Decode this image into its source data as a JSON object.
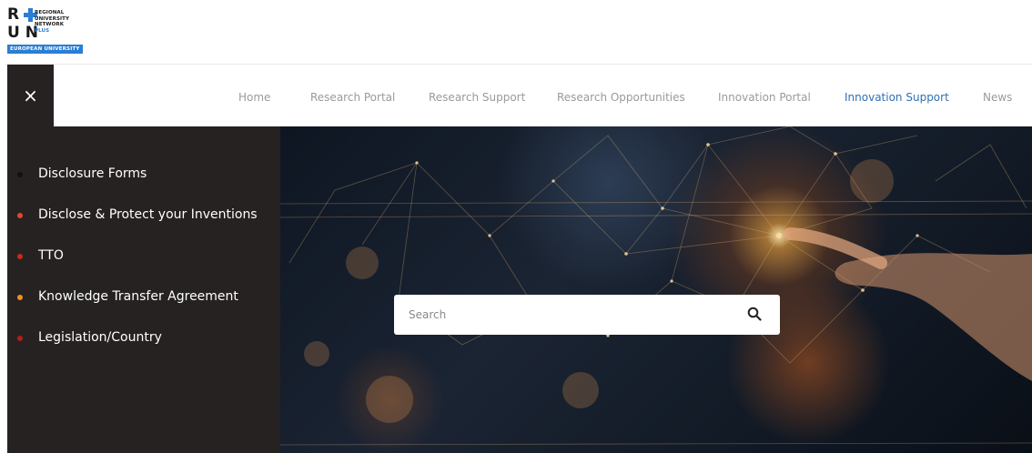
{
  "logo": {
    "letters_top": "R",
    "letters_bottom": "U N",
    "name_line1": "REGIONAL",
    "name_line2": "UNIVERSITY",
    "name_line3": "NETWORK",
    "name_line4": "PLUS",
    "banner": "EUROPEAN UNIVERSITY"
  },
  "nav": {
    "close_glyph": "×",
    "items": [
      {
        "label": "Home",
        "active": false
      },
      {
        "label": "Research Portal",
        "active": false
      },
      {
        "label": "Research Support",
        "active": false
      },
      {
        "label": "Research Opportunities",
        "active": false
      },
      {
        "label": "Innovation Portal",
        "active": false
      },
      {
        "label": "Innovation Support",
        "active": true
      },
      {
        "label": "News",
        "active": false
      }
    ],
    "active_color": "#2f6fb3"
  },
  "side_menu": {
    "items": [
      {
        "label": "Disclosure Forms",
        "bullet_color": "#111111"
      },
      {
        "label": "Disclose & Protect your Inventions",
        "bullet_color": "#e8432e"
      },
      {
        "label": "TTO",
        "bullet_color": "#c62a1f"
      },
      {
        "label": "Knowledge Transfer Agreement",
        "bullet_color": "#f0921e"
      },
      {
        "label": "Legislation/Country",
        "bullet_color": "#b01e1e"
      }
    ]
  },
  "search": {
    "placeholder": "Search",
    "value": "",
    "icon": "search-icon"
  },
  "colors": {
    "panel": "#262222",
    "brand_blue": "#2a7ed4"
  }
}
